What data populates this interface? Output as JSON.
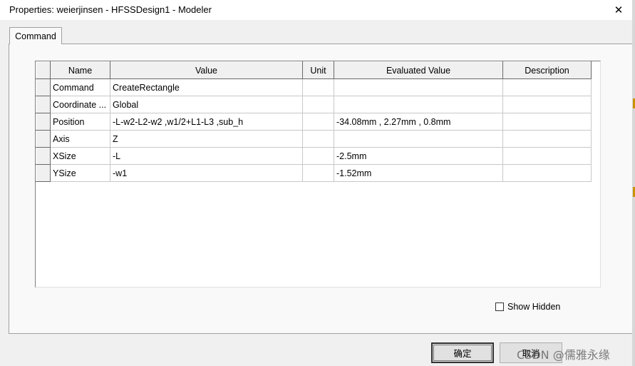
{
  "window": {
    "title": "Properties: weierjinsen - HFSSDesign1 - Modeler",
    "close_symbol": "✕"
  },
  "tabs": [
    {
      "label": "Command",
      "active": true
    }
  ],
  "grid": {
    "columns": [
      "Name",
      "Value",
      "Unit",
      "Evaluated Value",
      "Description"
    ],
    "rows": [
      {
        "name": "Command",
        "value": "CreateRectangle",
        "unit": "",
        "evaluated": "",
        "description": ""
      },
      {
        "name": "Coordinate ...",
        "value": "Global",
        "unit": "",
        "evaluated": "",
        "description": ""
      },
      {
        "name": "Position",
        "value": "-L-w2-L2-w2 ,w1/2+L1-L3 ,sub_h",
        "unit": "",
        "evaluated": "-34.08mm , 2.27mm , 0.8mm",
        "description": ""
      },
      {
        "name": "Axis",
        "value": "Z",
        "unit": "",
        "evaluated": "",
        "description": ""
      },
      {
        "name": "XSize",
        "value": "-L",
        "unit": "",
        "evaluated": "-2.5mm",
        "description": ""
      },
      {
        "name": "YSize",
        "value": "-w1",
        "unit": "",
        "evaluated": "-1.52mm",
        "description": ""
      }
    ]
  },
  "options": {
    "show_hidden_label": "Show Hidden",
    "show_hidden_checked": false
  },
  "buttons": {
    "ok_label": "确定",
    "cancel_label": "取消"
  },
  "watermark": "CSDN @儒雅永缘"
}
